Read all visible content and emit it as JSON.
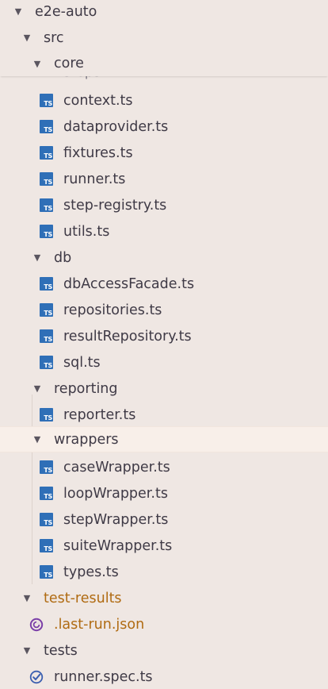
{
  "explorer": {
    "root": {
      "label": "e2e-auto"
    },
    "src": {
      "label": "src"
    },
    "core": {
      "label": "core",
      "hidden_above": "steps",
      "files": [
        "context.ts",
        "dataprovider.ts",
        "fixtures.ts",
        "runner.ts",
        "step-registry.ts",
        "utils.ts"
      ]
    },
    "db": {
      "label": "db",
      "files": [
        "dbAccessFacade.ts",
        "repositories.ts",
        "resultRepository.ts",
        "sql.ts"
      ]
    },
    "reporting": {
      "label": "reporting",
      "files": [
        "reporter.ts"
      ]
    },
    "wrappers": {
      "label": "wrappers",
      "files": [
        "caseWrapper.ts",
        "loopWrapper.ts",
        "stepWrapper.ts",
        "suiteWrapper.ts",
        "types.ts"
      ]
    },
    "test_results": {
      "label": "test-results",
      "files": [
        ".last-run.json"
      ]
    },
    "tests": {
      "label": "tests",
      "files": [
        "runner.spec.ts"
      ]
    }
  },
  "icons": {
    "ts_badge": "TS",
    "expanded": "chevron-down-icon",
    "json": "json-icon",
    "spec": "test-check-icon"
  },
  "colors": {
    "background": "#efe7e3",
    "selected_row": "#f8efe9",
    "ts_icon": "#2f6fb7",
    "git_ignored": "#b06b12",
    "json_icon": "#7b3fa8",
    "spec_icon": "#3b5fb0"
  }
}
